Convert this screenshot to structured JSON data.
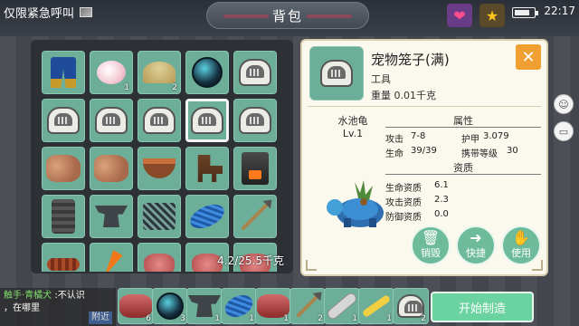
{
  "topbar": {
    "emergency_label": "仅限紧急呼叫",
    "title": "背包",
    "clock": "22:17"
  },
  "inventory": {
    "weight": "4.2/25.5千克",
    "slots": [
      {
        "icon": "pants-icon",
        "count": ""
      },
      {
        "icon": "salt-icon",
        "count": "1"
      },
      {
        "icon": "sand-pile-icon",
        "count": "2"
      },
      {
        "icon": "dark-orb-icon",
        "count": ""
      },
      {
        "icon": "pet-cage-icon",
        "count": ""
      },
      {
        "icon": "pet-cage-icon",
        "count": ""
      },
      {
        "icon": "pet-cage-icon",
        "count": ""
      },
      {
        "icon": "pet-cage-icon",
        "count": ""
      },
      {
        "icon": "pet-cage-icon",
        "count": ""
      },
      {
        "icon": "pet-cage-icon",
        "count": ""
      },
      {
        "icon": "hide-icon",
        "count": ""
      },
      {
        "icon": "hide-icon",
        "count": ""
      },
      {
        "icon": "cooking-pot-icon",
        "count": ""
      },
      {
        "icon": "horse-cart-icon",
        "count": ""
      },
      {
        "icon": "furnace-icon",
        "count": ""
      },
      {
        "icon": "stove-icon",
        "count": ""
      },
      {
        "icon": "anvil-icon",
        "count": ""
      },
      {
        "icon": "trap-icon",
        "count": ""
      },
      {
        "icon": "fishing-net-icon",
        "count": ""
      },
      {
        "icon": "spear-icon",
        "count": ""
      },
      {
        "icon": "worm-icon",
        "count": ""
      },
      {
        "icon": "carrot-icon",
        "count": ""
      },
      {
        "icon": "meat-icon",
        "count": ""
      },
      {
        "icon": "meat-icon",
        "count": ""
      },
      {
        "icon": "meat-icon",
        "count": ""
      }
    ]
  },
  "detail": {
    "name": "宠物笼子(满)",
    "category": "工具",
    "weight": "重量 0.01千克",
    "close": "✕",
    "pet_name": "水池龟",
    "pet_level": "Lv.1",
    "attr_title": "属性",
    "attrs": {
      "attack_label": "攻击",
      "attack_value": "7-8",
      "armor_label": "护甲",
      "armor_value": "3.079",
      "hp_label": "生命",
      "hp_value": "39/39",
      "carry_label": "携带等级",
      "carry_value": "30"
    },
    "aptitude_title": "资质",
    "aptitudes": {
      "hp_label": "生命资质",
      "hp_value": "6.1",
      "atk_label": "攻击资质",
      "atk_value": "2.3",
      "def_label": "防御资质",
      "def_value": "0.0"
    },
    "actions": {
      "destroy": "销毁",
      "shortcut": "快捷",
      "use": "使用"
    }
  },
  "chat": {
    "sender": "触手·青橘犬",
    "message": ":不认识",
    "line2": "，在哪里",
    "near": "附近"
  },
  "hotbar": {
    "craft_label": "开始制造",
    "items": [
      {
        "icon": "meat-icon",
        "count": "6"
      },
      {
        "icon": "dark-orb-icon",
        "count": "3"
      },
      {
        "icon": "anvil-icon",
        "count": "1"
      },
      {
        "icon": "fishing-net-icon",
        "count": "1"
      },
      {
        "icon": "meat-icon",
        "count": "1"
      },
      {
        "icon": "spear-icon",
        "count": "2"
      },
      {
        "icon": "fish-icon",
        "count": "1"
      },
      {
        "icon": "blade-icon",
        "count": "1"
      },
      {
        "icon": "pet-cage-icon",
        "count": "2"
      }
    ]
  },
  "colors": {
    "slot_green": "#6dae99",
    "close_orange": "#f0a030",
    "action_green": "#6dbb9a"
  }
}
